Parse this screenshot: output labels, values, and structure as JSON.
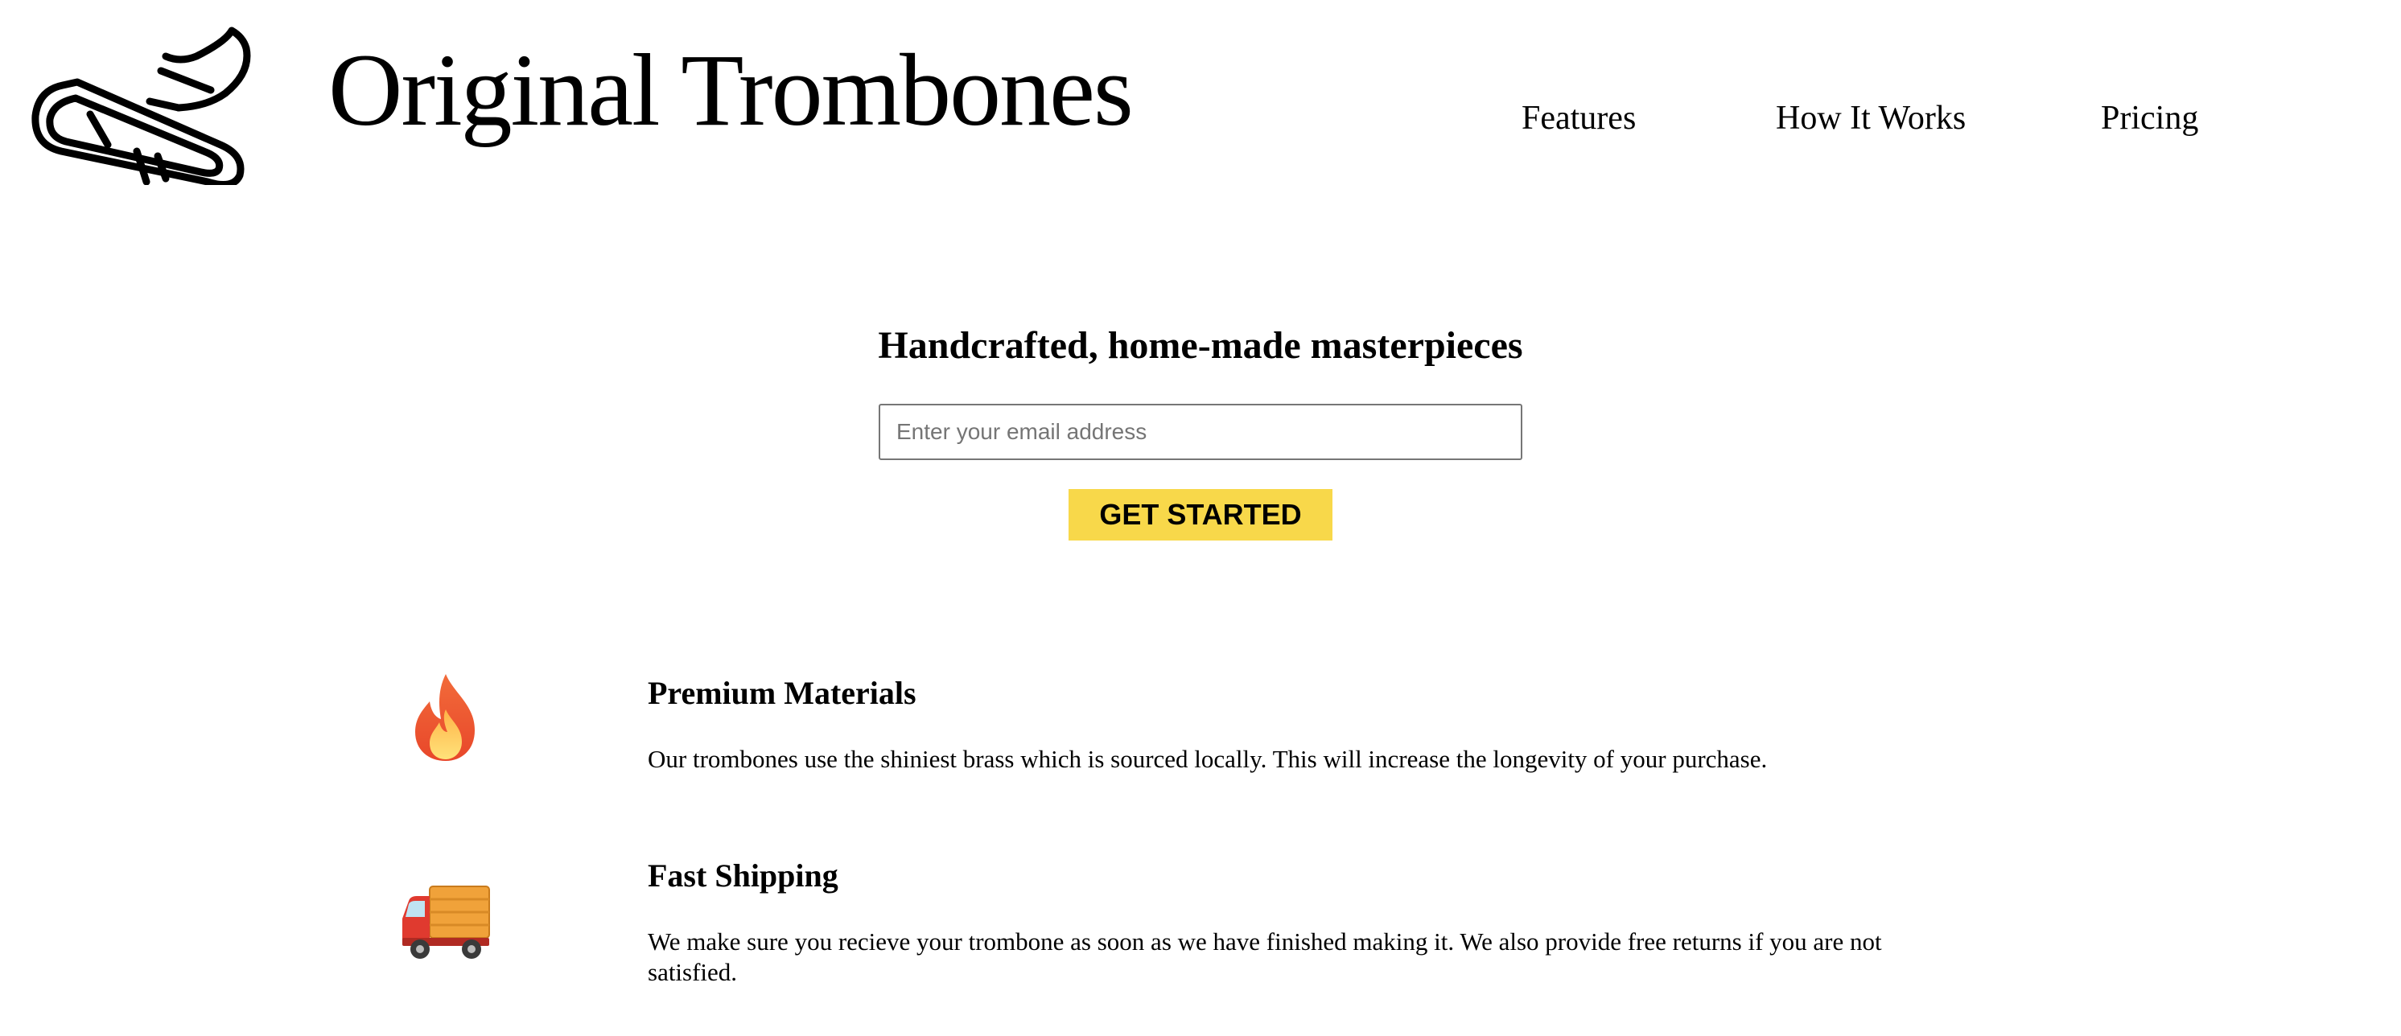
{
  "header": {
    "logo_icon": "trombone-icon",
    "title": "Original Trombones",
    "nav": {
      "features": "Features",
      "how_it_works": "How It Works",
      "pricing": "Pricing"
    }
  },
  "hero": {
    "title": "Handcrafted, home-made masterpieces",
    "email_placeholder": "Enter your email address",
    "email_value": "",
    "cta_label": "GET STARTED",
    "cta_color": "#f8d84a"
  },
  "features": {
    "materials": {
      "icon": "fire-icon",
      "title": "Premium Materials",
      "text": "Our trombones use the shiniest brass which is sourced locally. This will increase the longevity of your purchase."
    },
    "shipping": {
      "icon": "delivery-truck-icon",
      "title": "Fast Shipping",
      "text": "We make sure you recieve your trombone as soon as we have finished making it. We also provide free returns if you are not satisfied."
    }
  }
}
